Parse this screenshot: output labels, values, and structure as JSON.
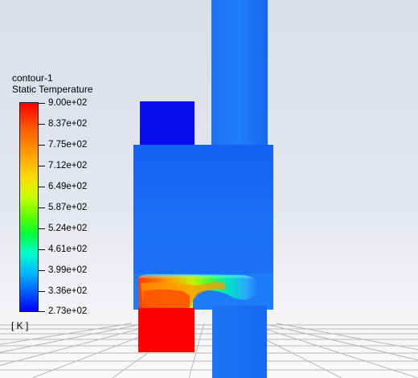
{
  "legend": {
    "contour_name": "contour-1",
    "variable": "Static Temperature",
    "unit": "[ K ]",
    "tick_labels": [
      "9.00e+02",
      "8.37e+02",
      "7.75e+02",
      "7.12e+02",
      "6.49e+02",
      "5.87e+02",
      "5.24e+02",
      "4.61e+02",
      "3.99e+02",
      "3.36e+02",
      "2.73e+02"
    ],
    "max": 900,
    "min": 273
  },
  "colors": {
    "cold": "#0000ff",
    "cool": "#1a66ff",
    "hot": "#ff0000"
  }
}
